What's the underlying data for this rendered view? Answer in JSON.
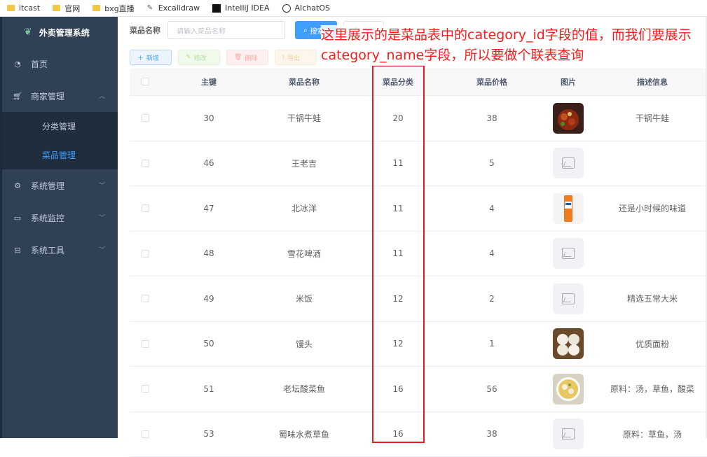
{
  "bookmarks": [
    {
      "label": "itcast",
      "icon": "folder-icon"
    },
    {
      "label": "官网",
      "icon": "folder-icon"
    },
    {
      "label": "bxg直播",
      "icon": "folder-icon"
    },
    {
      "label": "Excalidraw",
      "icon": "excalidraw-icon"
    },
    {
      "label": "IntelliJ IDEA",
      "icon": "intellij-icon"
    },
    {
      "label": "AIchatOS",
      "icon": "openai-icon"
    }
  ],
  "sidebar": {
    "title": "外卖管理系统",
    "items": [
      {
        "label": "首页",
        "icon": "dashboard-icon"
      },
      {
        "label": "商家管理",
        "icon": "cart-icon"
      },
      {
        "label": "分类管理"
      },
      {
        "label": "菜品管理"
      },
      {
        "label": "系统管理",
        "icon": "gear-icon"
      },
      {
        "label": "系统监控",
        "icon": "monitor-icon"
      },
      {
        "label": "系统工具",
        "icon": "toolbox-icon"
      }
    ]
  },
  "search": {
    "label": "菜品名称",
    "placeholder": "请输入菜品名称",
    "search_btn": "搜索",
    "reset_btn": "重置"
  },
  "toolbar": {
    "add": "新增",
    "edit": "修改",
    "delete": "删除",
    "export": "导出"
  },
  "table": {
    "headers": [
      "主键",
      "菜品名称",
      "菜品分类",
      "菜品价格",
      "图片",
      "描述信息"
    ],
    "rows": [
      {
        "id": "30",
        "name": "干锅牛蛙",
        "category": "20",
        "price": "38",
        "image": "photo",
        "desc": "干锅牛蛙"
      },
      {
        "id": "46",
        "name": "王老吉",
        "category": "11",
        "price": "5",
        "image": "placeholder",
        "desc": ""
      },
      {
        "id": "47",
        "name": "北冰洋",
        "category": "11",
        "price": "4",
        "image": "photo",
        "desc": "还是小时候的味道"
      },
      {
        "id": "48",
        "name": "雪花啤酒",
        "category": "11",
        "price": "4",
        "image": "placeholder",
        "desc": ""
      },
      {
        "id": "49",
        "name": "米饭",
        "category": "12",
        "price": "2",
        "image": "placeholder",
        "desc": "精选五常大米"
      },
      {
        "id": "50",
        "name": "馒头",
        "category": "12",
        "price": "1",
        "image": "photo",
        "desc": "优质面粉"
      },
      {
        "id": "51",
        "name": "老坛酸菜鱼",
        "category": "16",
        "price": "56",
        "image": "photo",
        "desc": "原料：汤，草鱼，酸菜"
      },
      {
        "id": "53",
        "name": "蜀味水煮草鱼",
        "category": "16",
        "price": "38",
        "image": "placeholder",
        "desc": "原料：草鱼，汤"
      }
    ]
  },
  "annotation": "这里展示的是菜品表中的category_id字段的值，而我们要展示category_name字段，所以要做个联表查询",
  "colors": {
    "sidebar": "#304156",
    "accent": "#409eff",
    "annotation": "#ff1a1a"
  }
}
